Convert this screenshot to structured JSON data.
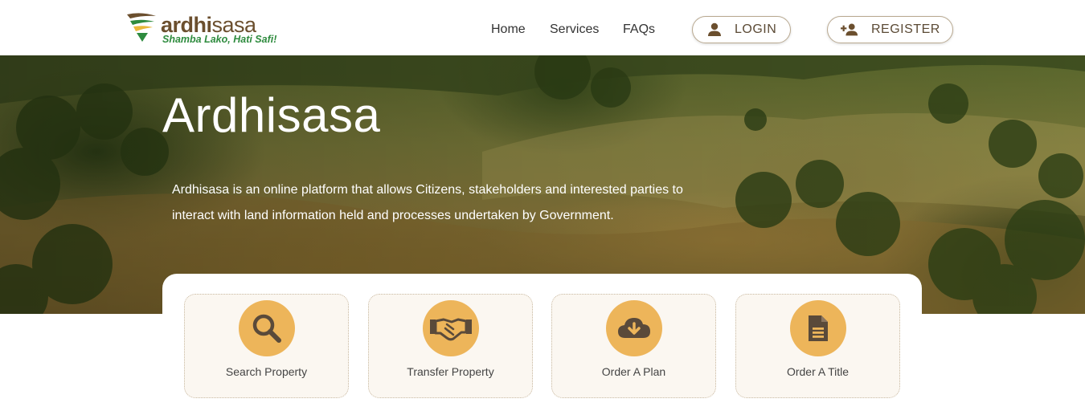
{
  "brand": {
    "name_part1": "ardhi",
    "name_part2": "sasa",
    "tagline": "Shamba Lako, Hati Safi!"
  },
  "nav": {
    "home": "Home",
    "services": "Services",
    "faqs": "FAQs",
    "login": "LOGIN",
    "register": "REGISTER"
  },
  "hero": {
    "title": "Ardhisasa",
    "description": "Ardhisasa is an online platform that allows Citizens, stakeholders and interested parties to interact with land information held and processes undertaken by Government."
  },
  "services": [
    {
      "label": "Search Property",
      "icon": "search-icon"
    },
    {
      "label": "Transfer Property",
      "icon": "handshake-icon"
    },
    {
      "label": "Order A Plan",
      "icon": "cloud-download-icon"
    },
    {
      "label": "Order A Title",
      "icon": "document-icon"
    }
  ],
  "colors": {
    "brand_brown": "#6b4f2e",
    "tagline_green": "#2e8b3e",
    "icon_circle": "#edb55a",
    "icon_glyph": "#5a4a3a",
    "card_bg": "#fbf7f1"
  }
}
